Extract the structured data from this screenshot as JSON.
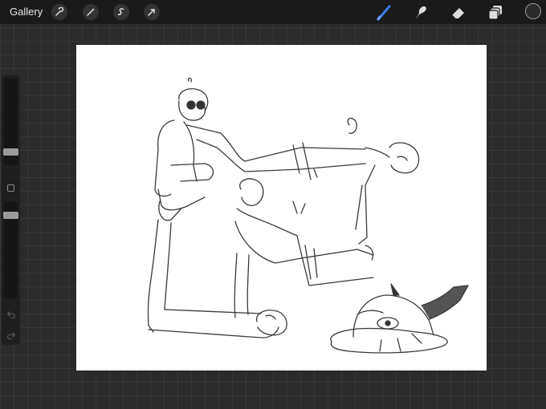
{
  "topbar": {
    "gallery_label": "Gallery",
    "left_tools": [
      "wrench-icon",
      "magic-wand-icon",
      "selection-icon",
      "transform-arrow-icon"
    ],
    "right_tools": [
      "brush-icon",
      "smudge-icon",
      "eraser-icon",
      "layers-icon"
    ],
    "active_tool": "brush-icon",
    "active_color": "#2a2a2a",
    "brush_accent": "#3d7be5"
  },
  "sidebar": {
    "size_slider_level": 0.75,
    "opacity_slider_level": 0.1,
    "icons": [
      "modify-square-icon",
      "undo-icon",
      "redo-icon"
    ]
  },
  "canvas": {
    "background": "#ffffff",
    "content": "pencil-sketch-drawing"
  }
}
